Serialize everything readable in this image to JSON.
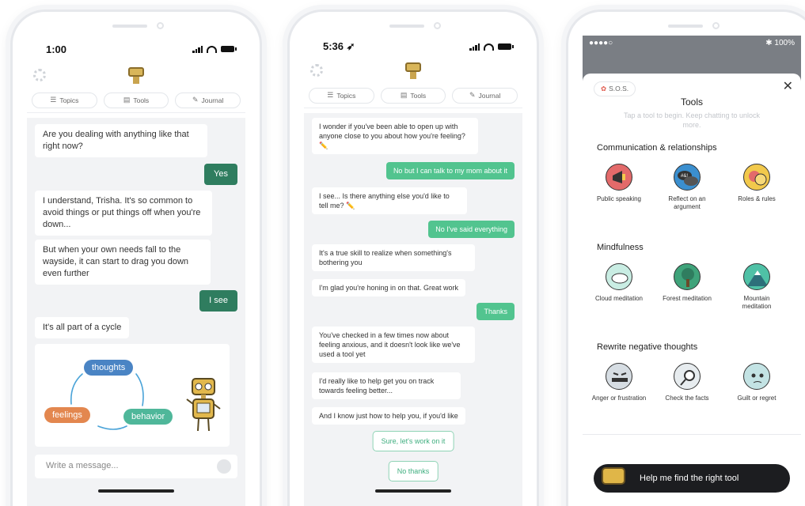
{
  "colors": {
    "user_bubble_phone1": "#2f7d5f",
    "user_bubble_phone2": "#52c48f",
    "thoughts_pill": "#4a84c4",
    "feelings_pill": "#e3874f",
    "behavior_pill": "#4fb79a",
    "arrow": "#4aa3d8"
  },
  "phone1": {
    "time": "1:00",
    "tabs": [
      "Topics",
      "Tools",
      "Journal"
    ],
    "messages": {
      "m1": "Are you dealing with anything like that right now?",
      "u1": "Yes",
      "m2": "I understand, Trisha. It's so common to avoid things or put things off when you're down...",
      "m3": "But when your own needs fall to the wayside, it can start to drag you down even further",
      "u2": "I see",
      "m4": "It's all part of a cycle"
    },
    "diagram": {
      "thoughts": "thoughts",
      "feelings": "feelings",
      "behavior": "behavior"
    },
    "composer_placeholder": "Write a message..."
  },
  "phone2": {
    "time": "5:36",
    "tabs": [
      "Topics",
      "Tools",
      "Journal"
    ],
    "messages": {
      "m1": "I wonder if you've been able to open up with anyone close to you about how you're feeling? ✏️",
      "u1": "No but I can talk to my mom about it",
      "m2": "I see... Is there anything else you'd like to tell me? ✏️",
      "u2": "No I've said everything",
      "m3": "It's a true skill to realize when something's bothering you",
      "m4": "I'm glad you're honing in on that. Great work",
      "u3": "Thanks",
      "m5": "You've checked in a few times now about feeling anxious, and it doesn't look like we've used a tool yet",
      "m6": "I'd really like to help get you on track towards feeling better...",
      "m7": "And I know just how to help you, if you'd like"
    },
    "options": [
      "Sure, let's work on it",
      "No thanks"
    ]
  },
  "phone3": {
    "status_left": "●●●●○",
    "status_right": "✱ 100%",
    "sos": "S.O.S.",
    "title": "Tools",
    "subtitle": "Tap a tool to begin. Keep chatting to unlock more.",
    "sections": [
      {
        "title": "Communication & relationships",
        "tools": [
          "Public speaking",
          "Reflect on an argument",
          "Roles & rules"
        ]
      },
      {
        "title": "Mindfulness",
        "tools": [
          "Cloud meditation",
          "Forest meditation",
          "Mountain meditation"
        ]
      },
      {
        "title": "Rewrite negative thoughts",
        "tools": [
          "Anger or frustration",
          "Check the facts",
          "Guilt or regret"
        ]
      }
    ],
    "cta": "Help me find the right tool"
  }
}
